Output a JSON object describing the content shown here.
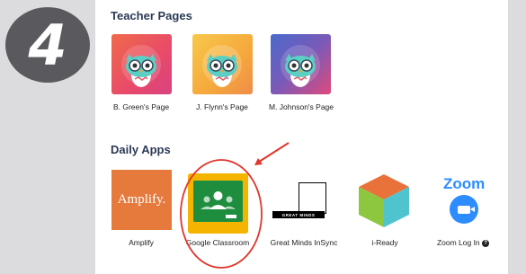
{
  "step_badge": {
    "number": "4"
  },
  "teacher_pages": {
    "title": "Teacher Pages",
    "items": [
      {
        "label": "B. Green's Page",
        "icon": "owl-icon"
      },
      {
        "label": "J. Flynn's Page",
        "icon": "owl-icon"
      },
      {
        "label": "M. Johnson's Page",
        "icon": "owl-icon"
      }
    ]
  },
  "daily_apps": {
    "title": "Daily Apps",
    "items": [
      {
        "label": "Amplify",
        "tile_text": "Amplify.",
        "icon": "amplify-logo"
      },
      {
        "label": "Google Classroom",
        "icon": "google-classroom-icon"
      },
      {
        "label": "Great Minds InSync",
        "tile_text": "GREAT MINDS",
        "icon": "great-minds-logo"
      },
      {
        "label": "i-Ready",
        "icon": "i-ready-cube-icon"
      },
      {
        "label": "Zoom Log In",
        "tile_text": "Zoom",
        "icon": "zoom-icon"
      }
    ]
  },
  "colors": {
    "accent_annotation": "#e0352b",
    "amplify": "#e57a3c",
    "classroom_yellow": "#f4b400",
    "classroom_green": "#1e8e3e",
    "zoom_blue": "#2d8cff"
  }
}
